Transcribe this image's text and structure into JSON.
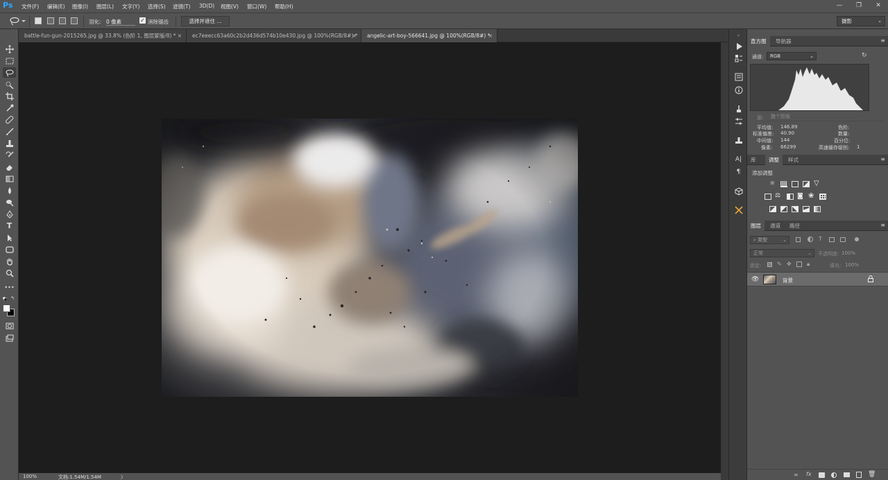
{
  "app": {
    "logo": "Ps"
  },
  "menu": [
    "文件(F)",
    "编辑(E)",
    "图像(I)",
    "图层(L)",
    "文字(Y)",
    "选择(S)",
    "滤镜(T)",
    "3D(D)",
    "视图(V)",
    "窗口(W)",
    "帮助(H)"
  ],
  "window_controls": {
    "minimize": "—",
    "restore": "❐",
    "close": "✕"
  },
  "options": {
    "feather_label": "羽化:",
    "feather_value": "0 像素",
    "antialias_label": "消除锯齿",
    "antialias_checked": true,
    "select_mask": "选择并遮住 ...",
    "workspace": "摄影"
  },
  "tabs": [
    {
      "label": "battle-fun-gun-2015265.jpg @ 33.8% (色阶 1, 图层蒙版/8) *",
      "close": "×",
      "active": false
    },
    {
      "label": "ec7eeecc63a60c2b2d436d574b10e430.jpg @ 100%(RGB/8#) *",
      "close": "×",
      "active": false
    },
    {
      "label": "angelic-art-boy-566641.jpg @ 100%(RGB/8#) *",
      "close": "×",
      "active": true
    }
  ],
  "status": {
    "zoom": "100%",
    "doc": "文档:1.54M/1.54M",
    "arrow": "〉"
  },
  "histogram": {
    "tabs": [
      "直方图",
      "导航器"
    ],
    "channel_label": "通道:",
    "channel_value": "RGB",
    "source_label": "源:",
    "source_value": "整个图像",
    "stats_left": [
      {
        "label": "平均值:",
        "value": "146.89"
      },
      {
        "label": "标准偏差:",
        "value": "40.90"
      },
      {
        "label": "中间值:",
        "value": "144"
      },
      {
        "label": "像素:",
        "value": "66299"
      }
    ],
    "stats_right": [
      {
        "label": "色阶:",
        "value": ""
      },
      {
        "label": "数量:",
        "value": ""
      },
      {
        "label": "百分位:",
        "value": ""
      },
      {
        "label": "高速缓存级别:",
        "value": "1"
      }
    ]
  },
  "adjustments": {
    "tabs": [
      "库",
      "调整",
      "样式"
    ],
    "title": "添加调整"
  },
  "layers": {
    "tabs": [
      "图层",
      "通道",
      "路径"
    ],
    "filter_label": "类型",
    "blend_mode": "正常",
    "opacity_label": "不透明度:",
    "opacity_value": "100%",
    "lock_label": "锁定:",
    "fill_label": "填充:",
    "fill_value": "100%",
    "items": [
      {
        "name": "背景",
        "visible": true,
        "locked": true
      }
    ]
  },
  "colors": {
    "ps_blue": "#31a8ff",
    "panel": "#535353",
    "canvas_bg": "#1d1d1d",
    "layer_selected": "#6b6b6b"
  }
}
